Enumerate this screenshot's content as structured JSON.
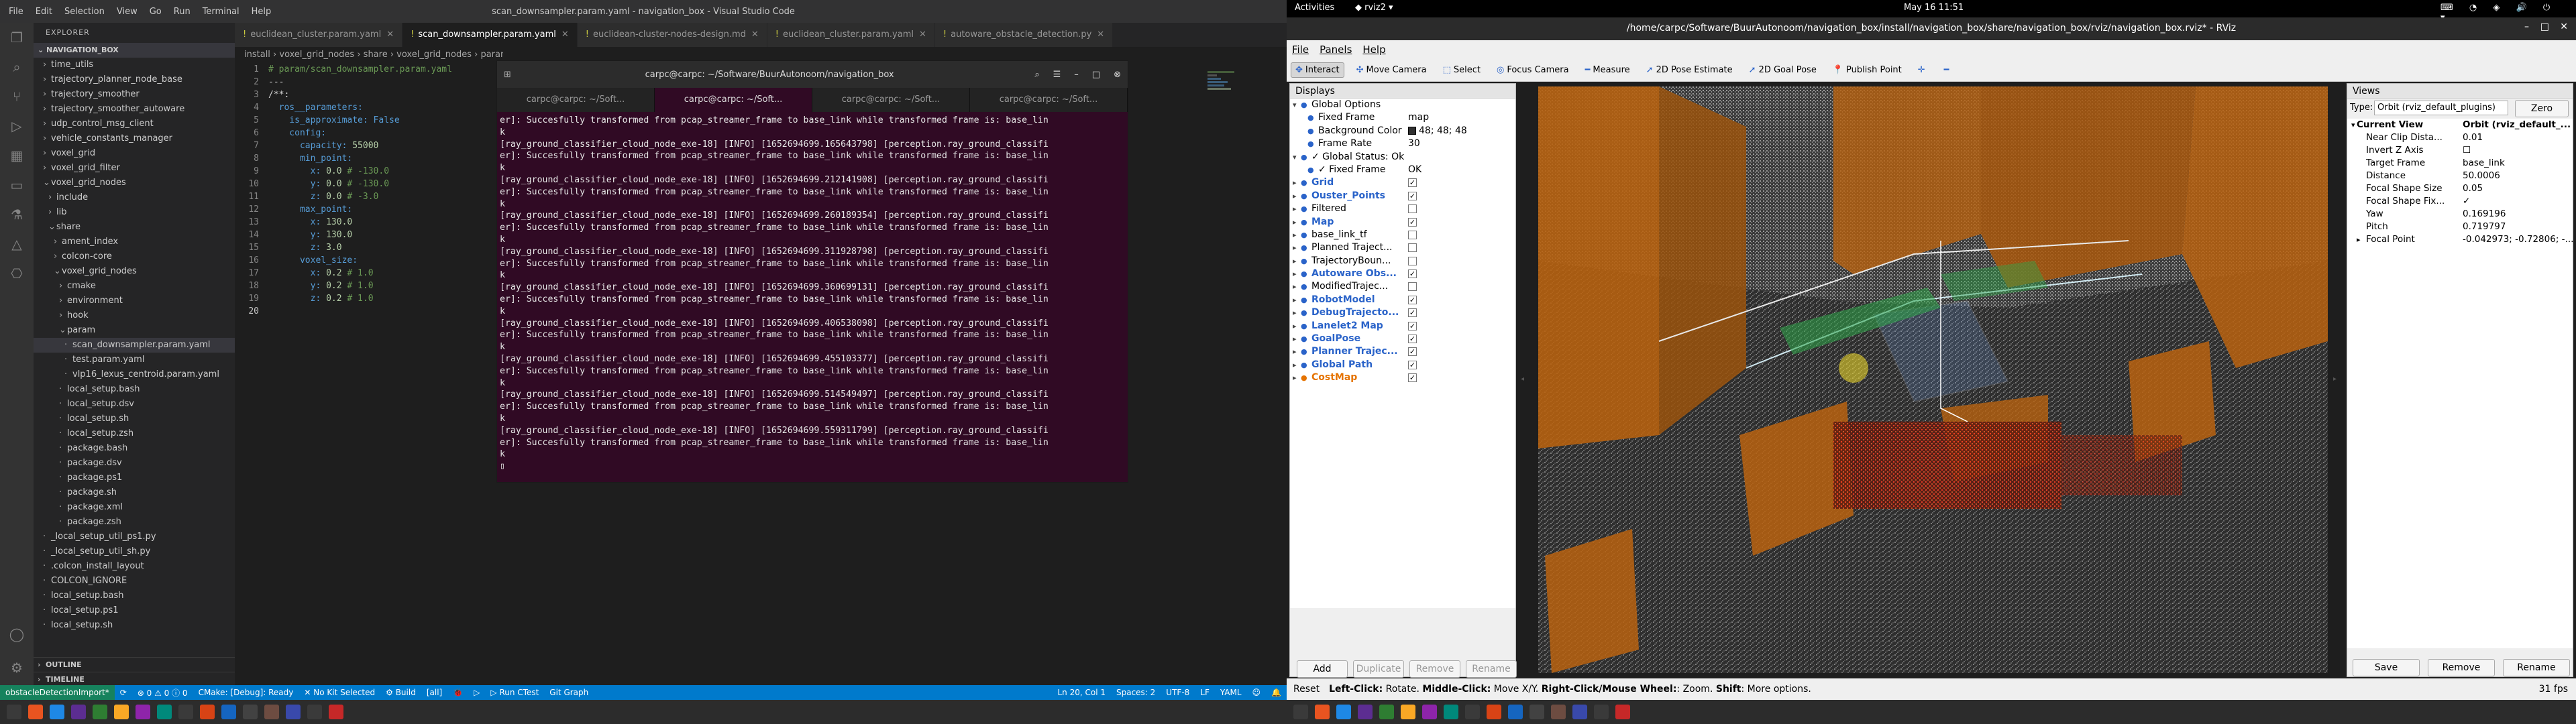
{
  "vscode": {
    "menu": [
      "File",
      "Edit",
      "Selection",
      "View",
      "Go",
      "Run",
      "Terminal",
      "Help"
    ],
    "title": "scan_downsampler.param.yaml - navigation_box - Visual Studio Code",
    "sidebar": {
      "header": "EXPLORER",
      "root": "NAVIGATION_BOX",
      "items": [
        {
          "label": "time_utils",
          "indent": 1,
          "chev": "›"
        },
        {
          "label": "trajectory_planner_node_base",
          "indent": 1,
          "chev": "›"
        },
        {
          "label": "trajectory_smoother",
          "indent": 1,
          "chev": "›"
        },
        {
          "label": "trajectory_smoother_autoware",
          "indent": 1,
          "chev": "›"
        },
        {
          "label": "udp_control_msg_client",
          "indent": 1,
          "chev": "›"
        },
        {
          "label": "vehicle_constants_manager",
          "indent": 1,
          "chev": "›"
        },
        {
          "label": "voxel_grid",
          "indent": 1,
          "chev": "›"
        },
        {
          "label": "voxel_grid_filter",
          "indent": 1,
          "chev": "›"
        },
        {
          "label": "voxel_grid_nodes",
          "indent": 1,
          "chev": "⌄"
        },
        {
          "label": "include",
          "indent": 2,
          "chev": "›"
        },
        {
          "label": "lib",
          "indent": 2,
          "chev": "›"
        },
        {
          "label": "share",
          "indent": 2,
          "chev": "⌄"
        },
        {
          "label": "ament_index",
          "indent": 3,
          "chev": "›"
        },
        {
          "label": "colcon-core",
          "indent": 3,
          "chev": "›"
        },
        {
          "label": "voxel_grid_nodes",
          "indent": 3,
          "chev": "⌄"
        },
        {
          "label": "cmake",
          "indent": 4,
          "chev": "›"
        },
        {
          "label": "environment",
          "indent": 4,
          "chev": "›"
        },
        {
          "label": "hook",
          "indent": 4,
          "chev": "›"
        },
        {
          "label": "param",
          "indent": 4,
          "chev": "⌄"
        },
        {
          "label": "scan_downsampler.param.yaml",
          "indent": 5,
          "chev": "",
          "sel": true
        },
        {
          "label": "test.param.yaml",
          "indent": 5,
          "chev": ""
        },
        {
          "label": "vlp16_lexus_centroid.param.yaml",
          "indent": 5,
          "chev": ""
        },
        {
          "label": "local_setup.bash",
          "indent": 4,
          "chev": ""
        },
        {
          "label": "local_setup.dsv",
          "indent": 4,
          "chev": ""
        },
        {
          "label": "local_setup.sh",
          "indent": 4,
          "chev": ""
        },
        {
          "label": "local_setup.zsh",
          "indent": 4,
          "chev": ""
        },
        {
          "label": "package.bash",
          "indent": 4,
          "chev": ""
        },
        {
          "label": "package.dsv",
          "indent": 4,
          "chev": ""
        },
        {
          "label": "package.ps1",
          "indent": 4,
          "chev": ""
        },
        {
          "label": "package.sh",
          "indent": 4,
          "chev": ""
        },
        {
          "label": "package.xml",
          "indent": 4,
          "chev": ""
        },
        {
          "label": "package.zsh",
          "indent": 4,
          "chev": ""
        },
        {
          "label": "_local_setup_util_ps1.py",
          "indent": 1,
          "chev": ""
        },
        {
          "label": "_local_setup_util_sh.py",
          "indent": 1,
          "chev": ""
        },
        {
          "label": ".colcon_install_layout",
          "indent": 1,
          "chev": ""
        },
        {
          "label": "COLCON_IGNORE",
          "indent": 1,
          "chev": ""
        },
        {
          "label": "local_setup.bash",
          "indent": 1,
          "chev": ""
        },
        {
          "label": "local_setup.ps1",
          "indent": 1,
          "chev": ""
        },
        {
          "label": "local_setup.sh",
          "indent": 1,
          "chev": ""
        }
      ],
      "outline": "OUTLINE",
      "timeline": "TIMELINE"
    },
    "tabs": [
      {
        "label": "euclidean_cluster.param.yaml",
        "active": false
      },
      {
        "label": "scan_downsampler.param.yaml",
        "active": true
      },
      {
        "label": "euclidean-cluster-nodes-design.md",
        "active": false
      },
      {
        "label": "euclidean_cluster.param.yaml",
        "active": false
      },
      {
        "label": "autoware_obstacle_detection.py",
        "active": false
      }
    ],
    "breadcrumb": "install › voxel_grid_nodes › share › voxel_grid_nodes › param",
    "code": [
      {
        "n": "1",
        "parts": [
          [
            "cm",
            "# param/scan_downsampler.param.yaml"
          ]
        ]
      },
      {
        "n": "2",
        "parts": [
          [
            "",
            "---"
          ]
        ]
      },
      {
        "n": "3",
        "parts": [
          [
            "",
            "/**:"
          ]
        ]
      },
      {
        "n": "4",
        "parts": [
          [
            "k",
            "  ros__parameters:"
          ]
        ]
      },
      {
        "n": "5",
        "parts": [
          [
            "k",
            "    is_approximate: "
          ],
          [
            "bl",
            "False"
          ]
        ]
      },
      {
        "n": "6",
        "parts": [
          [
            "k",
            "    config:"
          ]
        ]
      },
      {
        "n": "7",
        "parts": [
          [
            "k",
            "      capacity: "
          ],
          [
            "v",
            "55000"
          ]
        ]
      },
      {
        "n": "8",
        "parts": [
          [
            "k",
            "      min_point:"
          ]
        ]
      },
      {
        "n": "9",
        "parts": [
          [
            "k",
            "        x: "
          ],
          [
            "v",
            "0.0 "
          ],
          [
            "cm",
            "# -130.0"
          ]
        ]
      },
      {
        "n": "10",
        "parts": [
          [
            "k",
            "        y: "
          ],
          [
            "v",
            "0.0 "
          ],
          [
            "cm",
            "# -130.0"
          ]
        ]
      },
      {
        "n": "11",
        "parts": [
          [
            "k",
            "        z: "
          ],
          [
            "v",
            "0.0 "
          ],
          [
            "cm",
            "# -3.0"
          ]
        ]
      },
      {
        "n": "12",
        "parts": [
          [
            "k",
            "      max_point:"
          ]
        ]
      },
      {
        "n": "13",
        "parts": [
          [
            "k",
            "        x: "
          ],
          [
            "v",
            "130.0"
          ]
        ]
      },
      {
        "n": "14",
        "parts": [
          [
            "k",
            "        y: "
          ],
          [
            "v",
            "130.0"
          ]
        ]
      },
      {
        "n": "15",
        "parts": [
          [
            "k",
            "        z: "
          ],
          [
            "v",
            "3.0"
          ]
        ]
      },
      {
        "n": "16",
        "parts": [
          [
            "k",
            "      voxel_size:"
          ]
        ]
      },
      {
        "n": "17",
        "parts": [
          [
            "k",
            "        x: "
          ],
          [
            "v",
            "0.2 "
          ],
          [
            "cm",
            "# 1.0"
          ]
        ]
      },
      {
        "n": "18",
        "parts": [
          [
            "k",
            "        y: "
          ],
          [
            "v",
            "0.2 "
          ],
          [
            "cm",
            "# 1.0"
          ]
        ]
      },
      {
        "n": "19",
        "parts": [
          [
            "k",
            "        z: "
          ],
          [
            "v",
            "0.2 "
          ],
          [
            "cm",
            "# 1.0"
          ]
        ]
      },
      {
        "n": "20",
        "parts": [
          [
            "",
            ""
          ]
        ]
      }
    ],
    "status": {
      "remote": "obstacleDetectionImport*",
      "sync": "⟳",
      "problems": "⊗ 0 ⚠ 0 ⓘ 0",
      "cmake": "CMake: [Debug]: Ready",
      "kit": "✕ No Kit Selected",
      "build": "⚙ Build",
      "all": "[all]",
      "run": "▷ Run CTest",
      "git": "Git Graph",
      "pos": "Ln 20, Col 1",
      "spaces": "Spaces: 2",
      "enc": "UTF-8",
      "eol": "LF",
      "lang": "YAML"
    }
  },
  "terminal": {
    "title": "carpc@carpc: ~/Software/BuurAutonoom/navigation_box",
    "tabs": [
      "carpc@carpc: ~/Soft...",
      "carpc@carpc: ~/Soft...",
      "carpc@carpc: ~/Soft...",
      "carpc@carpc: ~/Soft..."
    ],
    "lines": [
      "er]: Succesfully transformed from pcap_streamer_frame to base_link while transformed frame is: base_lin",
      "k",
      "[ray_ground_classifier_cloud_node_exe-18] [INFO] [1652694699.165643798] [perception.ray_ground_classifi",
      "er]: Succesfully transformed from pcap_streamer_frame to base_link while transformed frame is: base_lin",
      "k",
      "[ray_ground_classifier_cloud_node_exe-18] [INFO] [1652694699.212141908] [perception.ray_ground_classifi",
      "er]: Succesfully transformed from pcap_streamer_frame to base_link while transformed frame is: base_lin",
      "k",
      "[ray_ground_classifier_cloud_node_exe-18] [INFO] [1652694699.260189354] [perception.ray_ground_classifi",
      "er]: Succesfully transformed from pcap_streamer_frame to base_link while transformed frame is: base_lin",
      "k",
      "[ray_ground_classifier_cloud_node_exe-18] [INFO] [1652694699.311928798] [perception.ray_ground_classifi",
      "er]: Succesfully transformed from pcap_streamer_frame to base_link while transformed frame is: base_lin",
      "k",
      "[ray_ground_classifier_cloud_node_exe-18] [INFO] [1652694699.360699131] [perception.ray_ground_classifi",
      "er]: Succesfully transformed from pcap_streamer_frame to base_link while transformed frame is: base_lin",
      "k",
      "[ray_ground_classifier_cloud_node_exe-18] [INFO] [1652694699.406538098] [perception.ray_ground_classifi",
      "er]: Succesfully transformed from pcap_streamer_frame to base_link while transformed frame is: base_lin",
      "k",
      "[ray_ground_classifier_cloud_node_exe-18] [INFO] [1652694699.455103377] [perception.ray_ground_classifi",
      "er]: Succesfully transformed from pcap_streamer_frame to base_link while transformed frame is: base_lin",
      "k",
      "[ray_ground_classifier_cloud_node_exe-18] [INFO] [1652694699.514549497] [perception.ray_ground_classifi",
      "er]: Succesfully transformed from pcap_streamer_frame to base_link while transformed frame is: base_lin",
      "k",
      "[ray_ground_classifier_cloud_node_exe-18] [INFO] [1652694699.559311799] [perception.ray_ground_classifi",
      "er]: Succesfully transformed from pcap_streamer_frame to base_link while transformed frame is: base_lin",
      "k",
      "▯"
    ]
  },
  "gnome": {
    "activities": "Activities",
    "app": "rviz2",
    "clock": "May 16  11:51"
  },
  "rviz": {
    "title": "/home/carpc/Software/BuurAutonoom/navigation_box/install/navigation_box/share/navigation_box/rviz/navigation_box.rviz* - RViz",
    "menu": [
      "File",
      "Panels",
      "Help"
    ],
    "tools": [
      {
        "label": "Interact",
        "icon": "✥",
        "active": true
      },
      {
        "label": "Move Camera",
        "icon": "✣",
        "active": false
      },
      {
        "label": "Select",
        "icon": "⬚",
        "active": false
      },
      {
        "label": "Focus Camera",
        "icon": "◎",
        "active": false
      },
      {
        "label": "Measure",
        "icon": "━",
        "active": false
      },
      {
        "label": "2D Pose Estimate",
        "icon": "➚",
        "active": false
      },
      {
        "label": "2D Goal Pose",
        "icon": "➚",
        "active": false
      },
      {
        "label": "Publish Point",
        "icon": "📍",
        "active": false
      },
      {
        "label": "",
        "icon": "✛",
        "active": false
      },
      {
        "label": "",
        "icon": "━",
        "active": false
      }
    ],
    "displays_title": "Displays",
    "displays": [
      {
        "name": "Global Options",
        "value": "",
        "indent": 0,
        "style": "",
        "check": null
      },
      {
        "name": "Fixed Frame",
        "value": "map",
        "indent": 1,
        "style": "",
        "check": null
      },
      {
        "name": "Background Color",
        "value": "48; 48; 48",
        "indent": 1,
        "style": "",
        "check": null,
        "swatch": "#303030"
      },
      {
        "name": "Frame Rate",
        "value": "30",
        "indent": 1,
        "style": "",
        "check": null
      },
      {
        "name": "✓ Global Status: Ok",
        "value": "",
        "indent": 0,
        "style": "",
        "check": null
      },
      {
        "name": "✓ Fixed Frame",
        "value": "OK",
        "indent": 1,
        "style": "",
        "check": null
      },
      {
        "name": "Grid",
        "value": "",
        "indent": 0,
        "style": "blue",
        "check": true
      },
      {
        "name": "Ouster_Points",
        "value": "",
        "indent": 0,
        "style": "blue",
        "check": true
      },
      {
        "name": "Filtered",
        "value": "",
        "indent": 0,
        "style": "",
        "check": false
      },
      {
        "name": "Map",
        "value": "",
        "indent": 0,
        "style": "blue",
        "check": true
      },
      {
        "name": "base_link_tf",
        "value": "",
        "indent": 0,
        "style": "",
        "check": false
      },
      {
        "name": "Planned Traject...",
        "value": "",
        "indent": 0,
        "style": "",
        "check": false
      },
      {
        "name": "TrajectoryBoun...",
        "value": "",
        "indent": 0,
        "style": "",
        "check": false
      },
      {
        "name": "Autoware Obs...",
        "value": "",
        "indent": 0,
        "style": "blue",
        "check": true
      },
      {
        "name": "ModifiedTrajec...",
        "value": "",
        "indent": 0,
        "style": "",
        "check": false
      },
      {
        "name": "RobotModel",
        "value": "",
        "indent": 0,
        "style": "blue",
        "check": true
      },
      {
        "name": "DebugTrajecto...",
        "value": "",
        "indent": 0,
        "style": "blue",
        "check": true
      },
      {
        "name": "Lanelet2 Map",
        "value": "",
        "indent": 0,
        "style": "blue",
        "check": true
      },
      {
        "name": "GoalPose",
        "value": "",
        "indent": 0,
        "style": "blue",
        "check": true
      },
      {
        "name": "Planner Trajec...",
        "value": "",
        "indent": 0,
        "style": "blue",
        "check": true
      },
      {
        "name": "Global Path",
        "value": "",
        "indent": 0,
        "style": "blue",
        "check": true
      },
      {
        "name": "CostMap",
        "value": "",
        "indent": 0,
        "style": "orange",
        "check": true
      }
    ],
    "display_buttons": [
      {
        "label": "Add",
        "enabled": true
      },
      {
        "label": "Duplicate",
        "enabled": false
      },
      {
        "label": "Remove",
        "enabled": false
      },
      {
        "label": "Rename",
        "enabled": false
      }
    ],
    "views": {
      "title": "Views",
      "type_label": "Type:",
      "type_value": "Orbit (rviz_default_plugins)",
      "zero": "Zero",
      "rows": [
        {
          "a": "Current View",
          "b": "Orbit (rviz_default_...",
          "bold": true
        },
        {
          "a": "Near Clip Dista...",
          "b": "0.01"
        },
        {
          "a": "Invert Z Axis",
          "b": "☐"
        },
        {
          "a": "Target Frame",
          "b": "base_link"
        },
        {
          "a": "Distance",
          "b": "50.0006"
        },
        {
          "a": "Focal Shape Size",
          "b": "0.05"
        },
        {
          "a": "Focal Shape Fix...",
          "b": "✓"
        },
        {
          "a": "Yaw",
          "b": "0.169196"
        },
        {
          "a": "Pitch",
          "b": "0.719797"
        },
        {
          "a": "Focal Point",
          "b": "-0.042973; -0.72806; -..."
        }
      ],
      "buttons": [
        "Save",
        "Remove",
        "Rename"
      ]
    },
    "status": {
      "reset": "Reset",
      "left_key": "Left-Click:",
      "left_txt": " Rotate. ",
      "mid_key": "Middle-Click:",
      "mid_txt": " Move X/Y. ",
      "right_key": "Right-Click/Mouse Wheel:",
      "right_txt": ": Zoom. ",
      "shift_key": "Shift",
      "shift_txt": ": More options.",
      "fps": "31 fps"
    }
  },
  "colors": {
    "vscode_status": "#007acc",
    "terminal_bg": "#300a24",
    "costmap": "#b8620f",
    "pointcloud": "#ffffff",
    "highlight": "#ff3b1f"
  }
}
